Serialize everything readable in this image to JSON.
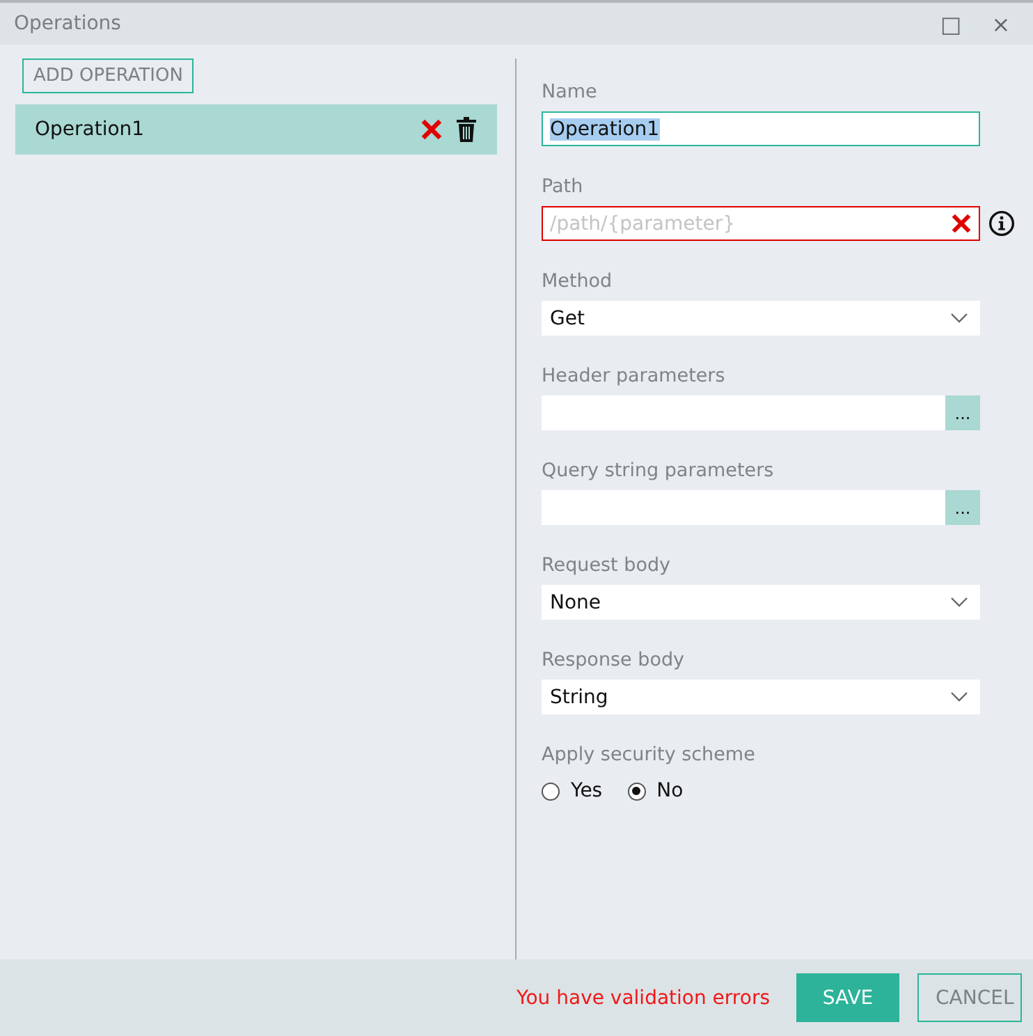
{
  "window": {
    "title": "Operations",
    "controls": [
      "□",
      "×"
    ]
  },
  "add_button": "ADD OPERATION",
  "operations": [
    {
      "name": "Operation1",
      "selected": true,
      "invalid": true
    }
  ],
  "fields": [
    {
      "kind": "text",
      "label": "Name",
      "value": "Operation1",
      "value_selected": true,
      "focused": true,
      "invalid": false
    },
    {
      "kind": "text",
      "label": "Path",
      "placeholder": "/path/{parameter}",
      "focused": false,
      "invalid": true,
      "info": true
    },
    {
      "kind": "dropdown",
      "label": "Method",
      "value": "Get"
    },
    {
      "kind": "picker",
      "label": "Header parameters",
      "button": "..."
    },
    {
      "kind": "picker",
      "label": "Query string parameters",
      "button": "..."
    },
    {
      "kind": "dropdown",
      "label": "Request body",
      "value": "None"
    },
    {
      "kind": "dropdown",
      "label": "Response body",
      "value": "String"
    },
    {
      "kind": "radio",
      "label": "Apply security scheme",
      "options": [
        {
          "label": "Yes",
          "selected": false
        },
        {
          "label": "No",
          "selected": true
        }
      ]
    }
  ],
  "footer": {
    "error": "You have validation errors",
    "buttons": [
      {
        "label": "SAVE",
        "kind": "primary"
      },
      {
        "label": "CANCEL",
        "kind": "secondary"
      }
    ]
  }
}
